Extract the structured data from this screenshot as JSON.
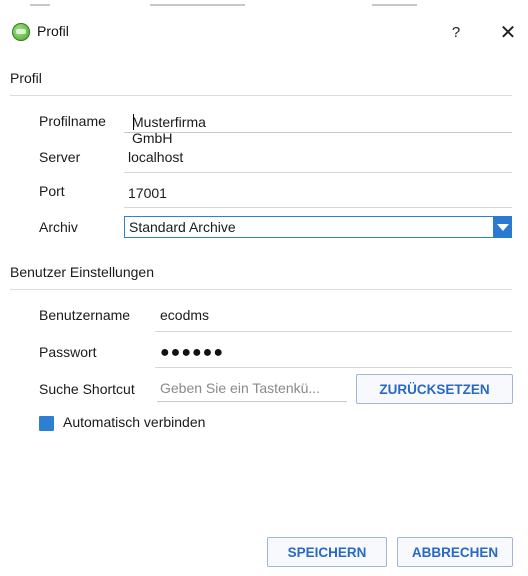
{
  "window": {
    "title": "Profil",
    "help_label": "?",
    "close_label": "✕",
    "icon": "ecodms-app-icon"
  },
  "profile_section": {
    "title": "Profil",
    "profilname_label": "Profilname",
    "profilname_value": "Musterfirma GmbH",
    "server_label": "Server",
    "server_value": "localhost",
    "port_label": "Port",
    "port_value": "17001",
    "archiv_label": "Archiv",
    "archiv_value": "Standard Archive"
  },
  "user_section": {
    "title": "Benutzer Einstellungen",
    "username_label": "Benutzername",
    "username_value": "ecodms",
    "password_label": "Passwort",
    "password_mask": "●●●●●●",
    "shortcut_label": "Suche Shortcut",
    "shortcut_placeholder": "Geben Sie ein Tastenkü...",
    "reset_button": "ZURÜCKSETZEN",
    "auto_connect_label": "Automatisch verbinden",
    "auto_connect_checked": true
  },
  "footer": {
    "save_button": "SPEICHERN",
    "cancel_button": "ABBRECHEN"
  },
  "colors": {
    "accent": "#2b79d0",
    "button_text": "#2868c6"
  }
}
